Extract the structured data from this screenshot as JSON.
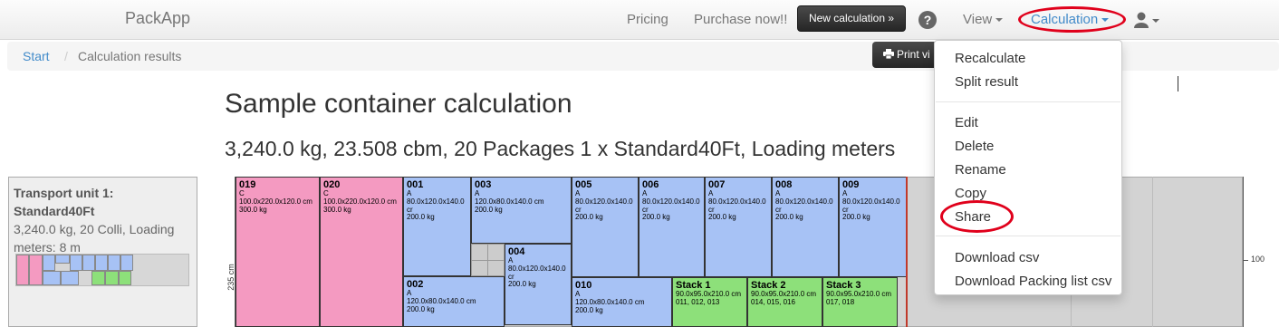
{
  "navbar": {
    "brand": "PackApp",
    "pricing": "Pricing",
    "purchase": "Purchase now!!",
    "new_calc": "New calculation »",
    "help": "?",
    "view": "View",
    "calculation": "Calculation"
  },
  "breadcrumb": {
    "start": "Start",
    "separator": "/",
    "current": "Calculation results"
  },
  "print_button": "Print vi",
  "title": "Sample container calculation",
  "summary": "3,240.0 kg, 23.508 cbm, 20 Packages 1 x Standard40Ft, Loading meters",
  "transport_unit": {
    "title_line1": "Transport unit 1:",
    "title_line2": "Standard40Ft",
    "meta_line1": "3,240.0 kg, 20 Colli, Loading",
    "meta_line2": "meters: 8 m"
  },
  "plot": {
    "ylabel": "235 cm",
    "tick_right": "100"
  },
  "packages": {
    "p019": {
      "id": "019",
      "type": "C",
      "dims": "100.0x220.0x120.0 cm",
      "weight": "300.0 kg"
    },
    "p020": {
      "id": "020",
      "type": "C",
      "dims": "100.0x220.0x120.0 cm",
      "weight": "300.0 kg"
    },
    "p001": {
      "id": "001",
      "type": "A",
      "dims": "80.0x120.0x140.0 cr",
      "weight": "200.0 kg"
    },
    "p003": {
      "id": "003",
      "type": "A",
      "dims": "120.0x80.0x140.0 cm",
      "weight": "200.0 kg"
    },
    "p004": {
      "id": "004",
      "type": "A",
      "dims": "80.0x120.0x140.0 cr",
      "weight": "200.0 kg"
    },
    "p002": {
      "id": "002",
      "type": "A",
      "dims": "120.0x80.0x140.0 cm",
      "weight": "200.0 kg"
    },
    "p005": {
      "id": "005",
      "type": "A",
      "dims": "80.0x120.0x140.0 cr",
      "weight": "200.0 kg"
    },
    "p006": {
      "id": "006",
      "type": "A",
      "dims": "80.0x120.0x140.0 cr",
      "weight": "200.0 kg"
    },
    "p007": {
      "id": "007",
      "type": "A",
      "dims": "80.0x120.0x140.0 cr",
      "weight": "200.0 kg"
    },
    "p008": {
      "id": "008",
      "type": "A",
      "dims": "80.0x120.0x140.0 cr",
      "weight": "200.0 kg"
    },
    "p009": {
      "id": "009",
      "type": "A",
      "dims": "80.0x120.0x140.0 cr",
      "weight": "200.0 kg"
    },
    "p010": {
      "id": "010",
      "type": "A",
      "dims": "120.0x80.0x140.0 cm",
      "weight": "200.0 kg"
    },
    "stack1": {
      "id": "Stack 1",
      "dims": "90.0x95.0x210.0 cm",
      "members": "011, 012, 013"
    },
    "stack2": {
      "id": "Stack 2",
      "dims": "90.0x95.0x210.0 cm",
      "members": "014, 015, 016"
    },
    "stack3": {
      "id": "Stack 3",
      "dims": "90.0x95.0x210.0 cm",
      "members": "017, 018"
    }
  },
  "dropdown": {
    "recalculate": "Recalculate",
    "split": "Split result",
    "edit": "Edit",
    "delete": "Delete",
    "rename": "Rename",
    "copy": "Copy",
    "share": "Share",
    "download_csv": "Download csv",
    "download_packing": "Download Packing list csv"
  },
  "colors": {
    "pink": "#f49ac1",
    "blue": "#a7c2f5",
    "green": "#8de07a",
    "highlight": "#e0001b",
    "link": "#428bca"
  }
}
